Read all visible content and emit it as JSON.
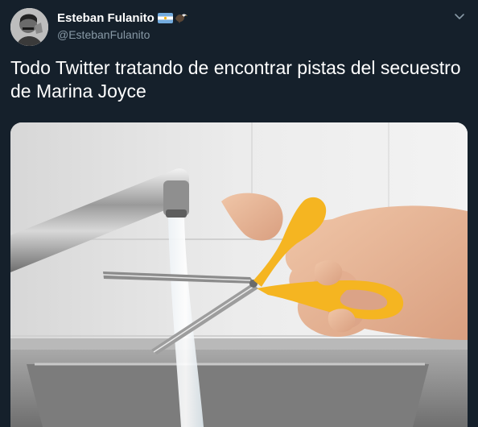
{
  "tweet": {
    "author": {
      "display_name": "Esteban Fulanito",
      "handle": "@EstebanFulanito",
      "badges": [
        "argentina-flag-icon",
        "eagle-icon"
      ]
    },
    "text": "Todo Twitter tratando de encontrar pistas del secuestro de Marina Joyce",
    "menu_icon": "chevron-down-icon",
    "media": {
      "description_icon": "photo"
    }
  },
  "colors": {
    "background": "#15202b",
    "text_primary": "#ffffff",
    "text_secondary": "#8899a6",
    "scissors_handle": "#f5b521"
  }
}
